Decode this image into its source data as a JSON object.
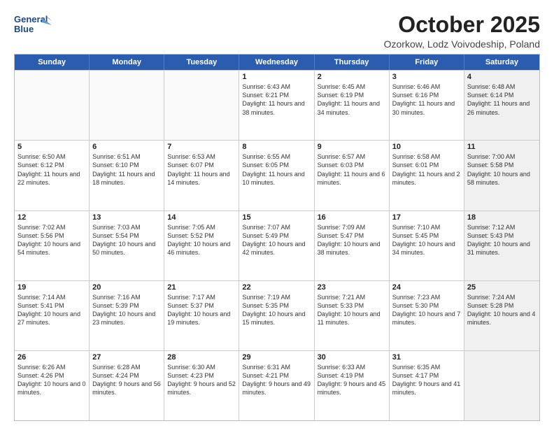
{
  "header": {
    "logo_line1": "General",
    "logo_line2": "Blue",
    "title": "October 2025",
    "subtitle": "Ozorkow, Lodz Voivodeship, Poland"
  },
  "weekdays": [
    "Sunday",
    "Monday",
    "Tuesday",
    "Wednesday",
    "Thursday",
    "Friday",
    "Saturday"
  ],
  "rows": [
    [
      {
        "day": "",
        "text": "",
        "empty": true
      },
      {
        "day": "",
        "text": "",
        "empty": true
      },
      {
        "day": "",
        "text": "",
        "empty": true
      },
      {
        "day": "1",
        "text": "Sunrise: 6:43 AM\nSunset: 6:21 PM\nDaylight: 11 hours\nand 38 minutes."
      },
      {
        "day": "2",
        "text": "Sunrise: 6:45 AM\nSunset: 6:19 PM\nDaylight: 11 hours\nand 34 minutes."
      },
      {
        "day": "3",
        "text": "Sunrise: 6:46 AM\nSunset: 6:16 PM\nDaylight: 11 hours\nand 30 minutes."
      },
      {
        "day": "4",
        "text": "Sunrise: 6:48 AM\nSunset: 6:14 PM\nDaylight: 11 hours\nand 26 minutes.",
        "shaded": true
      }
    ],
    [
      {
        "day": "5",
        "text": "Sunrise: 6:50 AM\nSunset: 6:12 PM\nDaylight: 11 hours\nand 22 minutes."
      },
      {
        "day": "6",
        "text": "Sunrise: 6:51 AM\nSunset: 6:10 PM\nDaylight: 11 hours\nand 18 minutes."
      },
      {
        "day": "7",
        "text": "Sunrise: 6:53 AM\nSunset: 6:07 PM\nDaylight: 11 hours\nand 14 minutes."
      },
      {
        "day": "8",
        "text": "Sunrise: 6:55 AM\nSunset: 6:05 PM\nDaylight: 11 hours\nand 10 minutes."
      },
      {
        "day": "9",
        "text": "Sunrise: 6:57 AM\nSunset: 6:03 PM\nDaylight: 11 hours\nand 6 minutes."
      },
      {
        "day": "10",
        "text": "Sunrise: 6:58 AM\nSunset: 6:01 PM\nDaylight: 11 hours\nand 2 minutes."
      },
      {
        "day": "11",
        "text": "Sunrise: 7:00 AM\nSunset: 5:58 PM\nDaylight: 10 hours\nand 58 minutes.",
        "shaded": true
      }
    ],
    [
      {
        "day": "12",
        "text": "Sunrise: 7:02 AM\nSunset: 5:56 PM\nDaylight: 10 hours\nand 54 minutes."
      },
      {
        "day": "13",
        "text": "Sunrise: 7:03 AM\nSunset: 5:54 PM\nDaylight: 10 hours\nand 50 minutes."
      },
      {
        "day": "14",
        "text": "Sunrise: 7:05 AM\nSunset: 5:52 PM\nDaylight: 10 hours\nand 46 minutes."
      },
      {
        "day": "15",
        "text": "Sunrise: 7:07 AM\nSunset: 5:49 PM\nDaylight: 10 hours\nand 42 minutes."
      },
      {
        "day": "16",
        "text": "Sunrise: 7:09 AM\nSunset: 5:47 PM\nDaylight: 10 hours\nand 38 minutes."
      },
      {
        "day": "17",
        "text": "Sunrise: 7:10 AM\nSunset: 5:45 PM\nDaylight: 10 hours\nand 34 minutes."
      },
      {
        "day": "18",
        "text": "Sunrise: 7:12 AM\nSunset: 5:43 PM\nDaylight: 10 hours\nand 31 minutes.",
        "shaded": true
      }
    ],
    [
      {
        "day": "19",
        "text": "Sunrise: 7:14 AM\nSunset: 5:41 PM\nDaylight: 10 hours\nand 27 minutes."
      },
      {
        "day": "20",
        "text": "Sunrise: 7:16 AM\nSunset: 5:39 PM\nDaylight: 10 hours\nand 23 minutes."
      },
      {
        "day": "21",
        "text": "Sunrise: 7:17 AM\nSunset: 5:37 PM\nDaylight: 10 hours\nand 19 minutes."
      },
      {
        "day": "22",
        "text": "Sunrise: 7:19 AM\nSunset: 5:35 PM\nDaylight: 10 hours\nand 15 minutes."
      },
      {
        "day": "23",
        "text": "Sunrise: 7:21 AM\nSunset: 5:33 PM\nDaylight: 10 hours\nand 11 minutes."
      },
      {
        "day": "24",
        "text": "Sunrise: 7:23 AM\nSunset: 5:30 PM\nDaylight: 10 hours\nand 7 minutes."
      },
      {
        "day": "25",
        "text": "Sunrise: 7:24 AM\nSunset: 5:28 PM\nDaylight: 10 hours\nand 4 minutes.",
        "shaded": true
      }
    ],
    [
      {
        "day": "26",
        "text": "Sunrise: 6:26 AM\nSunset: 4:26 PM\nDaylight: 10 hours\nand 0 minutes."
      },
      {
        "day": "27",
        "text": "Sunrise: 6:28 AM\nSunset: 4:24 PM\nDaylight: 9 hours\nand 56 minutes."
      },
      {
        "day": "28",
        "text": "Sunrise: 6:30 AM\nSunset: 4:23 PM\nDaylight: 9 hours\nand 52 minutes."
      },
      {
        "day": "29",
        "text": "Sunrise: 6:31 AM\nSunset: 4:21 PM\nDaylight: 9 hours\nand 49 minutes."
      },
      {
        "day": "30",
        "text": "Sunrise: 6:33 AM\nSunset: 4:19 PM\nDaylight: 9 hours\nand 45 minutes."
      },
      {
        "day": "31",
        "text": "Sunrise: 6:35 AM\nSunset: 4:17 PM\nDaylight: 9 hours\nand 41 minutes."
      },
      {
        "day": "",
        "text": "",
        "empty": true,
        "shaded": true
      }
    ]
  ]
}
